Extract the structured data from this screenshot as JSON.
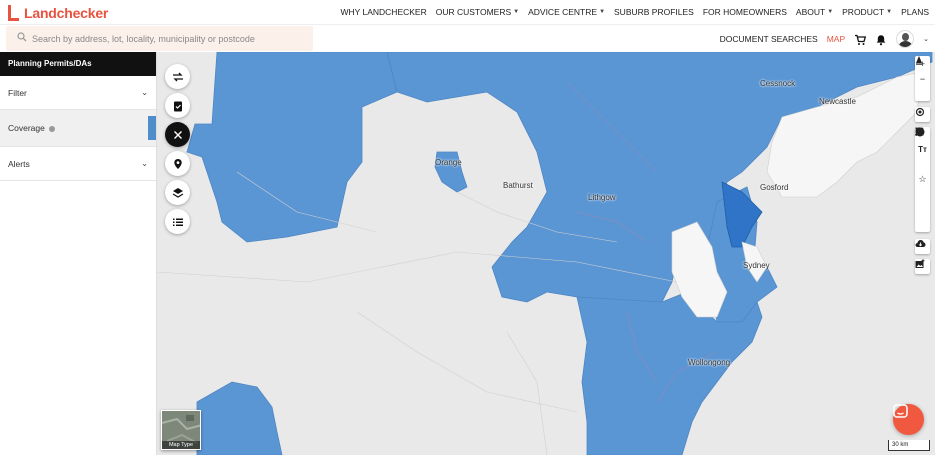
{
  "brand": {
    "name": "Landchecker"
  },
  "nav": {
    "items": [
      {
        "label": "WHY LANDCHECKER",
        "has_caret": false
      },
      {
        "label": "OUR CUSTOMERS",
        "has_caret": true
      },
      {
        "label": "ADVICE CENTRE",
        "has_caret": true
      },
      {
        "label": "SUBURB PROFILES",
        "has_caret": false
      },
      {
        "label": "FOR HOMEOWNERS",
        "has_caret": false
      },
      {
        "label": "ABOUT",
        "has_caret": true
      },
      {
        "label": "PRODUCT",
        "has_caret": true
      },
      {
        "label": "PLANS",
        "has_caret": false
      }
    ]
  },
  "search": {
    "placeholder": "Search by address, lot, locality, municipality or postcode",
    "value": ""
  },
  "tools": {
    "document_searches": "DOCUMENT SEARCHES",
    "map": "MAP"
  },
  "sidebar": {
    "header": "Planning Permits/DAs",
    "filter": "Filter",
    "coverage": "Coverage",
    "alerts": "Alerts"
  },
  "map": {
    "places": {
      "cessnock": "Cessnock",
      "newcastle": "Newcastle",
      "orange": "Orange",
      "bathurst": "Bathurst",
      "lithgow": "Lithgow",
      "gosford": "Gosford",
      "sydney": "Sydney",
      "wollongong": "Wollongong"
    },
    "map_type_label": "Map Type",
    "scale_label": "30 km"
  },
  "colors": {
    "accent": "#e8533f",
    "coverage_fill": "#5b96d4",
    "coverage_dark": "#2f74c7",
    "land": "#e9e9e9",
    "urban": "#f6f6f6"
  }
}
